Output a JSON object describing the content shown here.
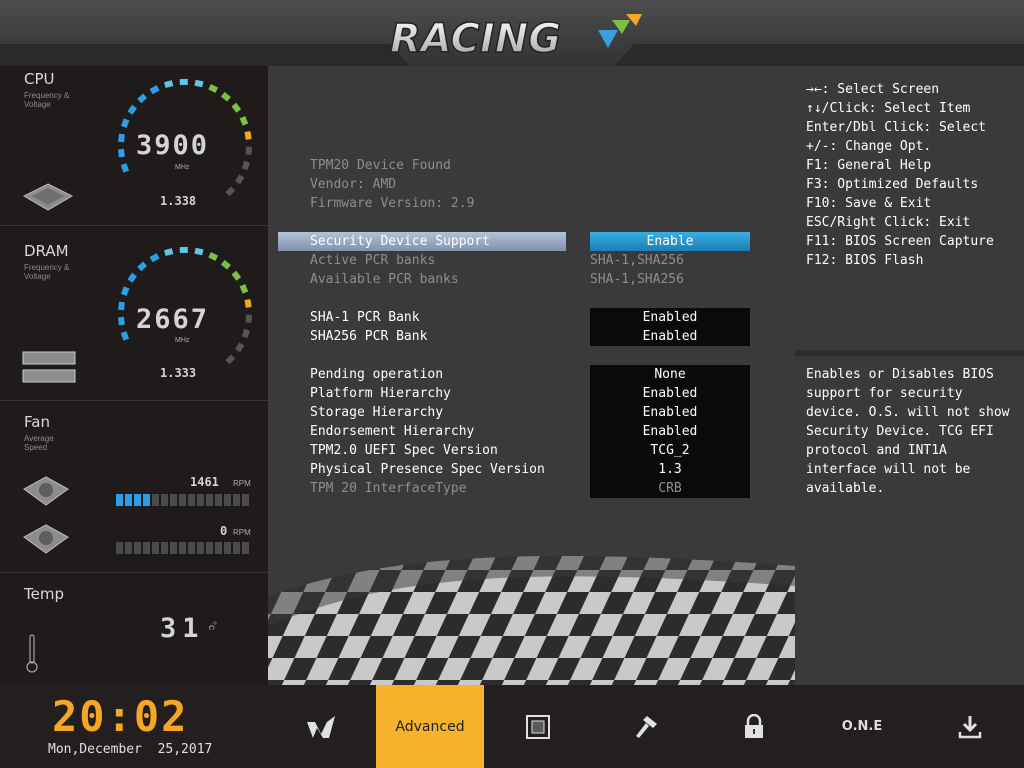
{
  "header": {
    "logo_text": "RACING"
  },
  "sidebar": {
    "cpu": {
      "title": "CPU",
      "subtitle": "Frequency & Voltage",
      "frequency": "3900",
      "unit": "MHz",
      "voltage": "1.338"
    },
    "dram": {
      "title": "DRAM",
      "subtitle": "Frequency & Voltage",
      "frequency": "2667",
      "unit": "MHz",
      "voltage": "1.333"
    },
    "fan": {
      "title": "Fan",
      "subtitle": "Average Speed",
      "fans": [
        {
          "rpm": "1461",
          "unit": "RPM",
          "level": 0.25
        },
        {
          "rpm": "0",
          "unit": "RPM",
          "level": 0
        }
      ]
    },
    "temp": {
      "title": "Temp",
      "value": "31",
      "unit": "°c"
    }
  },
  "main": {
    "info": [
      "TPM20 Device Found",
      "Vendor: AMD",
      "Firmware Version: 2.9"
    ],
    "settings": [
      {
        "label": "Security Device Support",
        "value": "Enable",
        "style": "selected"
      },
      {
        "label": "Active PCR banks",
        "value": "SHA-1,SHA256",
        "style": "readonly"
      },
      {
        "label": "Available PCR banks",
        "value": "SHA-1,SHA256",
        "style": "readonly"
      },
      {
        "label": "SHA-1 PCR Bank",
        "value": "Enabled",
        "style": "option"
      },
      {
        "label": "SHA256 PCR Bank",
        "value": "Enabled",
        "style": "option"
      },
      {
        "label": "Pending operation",
        "value": "None",
        "style": "option"
      },
      {
        "label": "Platform Hierarchy",
        "value": "Enabled",
        "style": "option"
      },
      {
        "label": "Storage Hierarchy",
        "value": "Enabled",
        "style": "option"
      },
      {
        "label": "Endorsement Hierarchy",
        "value": "Enabled",
        "style": "option"
      },
      {
        "label": "TPM2.0 UEFI Spec Version",
        "value": "TCG_2",
        "style": "option"
      },
      {
        "label": "Physical Presence Spec Version",
        "value": "1.3",
        "style": "option"
      },
      {
        "label": "TPM 20 InterfaceType",
        "value": "CRB",
        "style": "disabled"
      }
    ]
  },
  "help": {
    "keys": [
      "→←: Select Screen",
      "↑↓/Click: Select Item",
      "Enter/Dbl Click: Select",
      "+/-: Change Opt.",
      "F1: General Help",
      "F3: Optimized Defaults",
      "F10: Save & Exit",
      "ESC/Right Click: Exit",
      "F11: BIOS Screen Capture",
      "F12: BIOS Flash"
    ],
    "description": "Enables or Disables BIOS support for security device. O.S. will not show Security Device. TCG EFI protocol and INT1A interface will not be available."
  },
  "footer": {
    "time": "20:02",
    "date": "Mon,December  25,2017",
    "tabs": [
      {
        "id": "main-tab",
        "icon": "racing-logo-icon"
      },
      {
        "id": "advanced-tab",
        "label": "Advanced",
        "active": true
      },
      {
        "id": "chipset-tab",
        "icon": "chip-icon"
      },
      {
        "id": "tools-tab",
        "icon": "hammer-icon"
      },
      {
        "id": "security-tab",
        "icon": "lock-icon"
      },
      {
        "id": "one-tab",
        "label": "O.N.E"
      },
      {
        "id": "save-exit-tab",
        "icon": "download-icon"
      }
    ]
  },
  "colors": {
    "accent": "#f6b22b",
    "gauge_blue": "#2c9ee6",
    "gauge_green": "#7bc043",
    "select_blue": "#1a7fb8"
  }
}
